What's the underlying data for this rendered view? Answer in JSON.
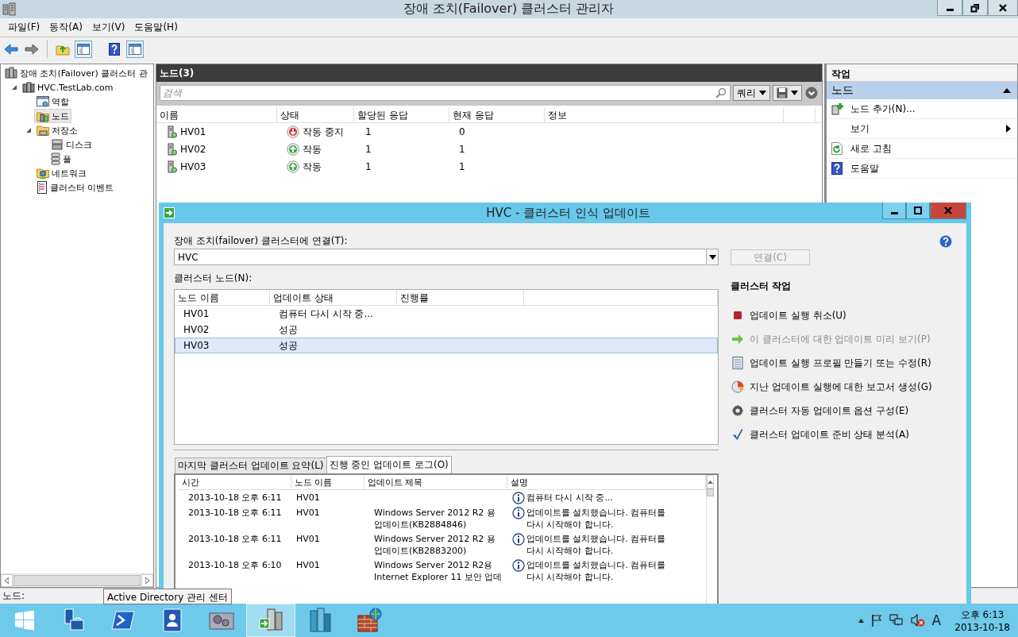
{
  "window": {
    "title": "장애 조치(Failover) 클러스터 관리자"
  },
  "menu": [
    "파일(F)",
    "동작(A)",
    "보기(V)",
    "도움말(H)"
  ],
  "tree": {
    "label": "장애 조치(Failover) 클러스터 관",
    "kind": "cluster",
    "selected": false,
    "children": [
      {
        "label": "HVC.TestLab.com",
        "kind": "server",
        "selected": false,
        "expanded": true,
        "children": [
          {
            "label": "역할",
            "kind": "roles",
            "selected": false
          },
          {
            "label": "노드",
            "kind": "nodes",
            "selected": true
          },
          {
            "label": "저장소",
            "kind": "storage",
            "selected": false,
            "expanded": true,
            "children": [
              {
                "label": "디스크",
                "kind": "disk",
                "selected": false
              },
              {
                "label": "풀",
                "kind": "pool",
                "selected": false
              }
            ]
          },
          {
            "label": "네트워크",
            "kind": "network",
            "selected": false
          },
          {
            "label": "클러스터 이벤트",
            "kind": "events",
            "selected": false
          }
        ]
      }
    ]
  },
  "center": {
    "title": "노드(3)",
    "search": {
      "placeholder": "검색"
    },
    "query_button": "쿼리",
    "columns": [
      "이름",
      "상태",
      "할당된 응답",
      "현재 응답",
      "정보"
    ],
    "rows": [
      {
        "name": "HV01",
        "status": "작동 중지",
        "kind": "down",
        "assigned": "1",
        "current": "0"
      },
      {
        "name": "HV02",
        "status": "작동",
        "kind": "up",
        "assigned": "1",
        "current": "1"
      },
      {
        "name": "HV03",
        "status": "작동",
        "kind": "up",
        "assigned": "1",
        "current": "1"
      }
    ]
  },
  "actions": {
    "title": "작업",
    "section": {
      "label": "노드",
      "expanded": true
    },
    "items": [
      {
        "label": "노드 추가(N)...",
        "kind": "add"
      },
      {
        "label": "보기",
        "kind": "submenu"
      },
      {
        "label": "새로 고침",
        "kind": "refresh"
      },
      {
        "label": "도움말",
        "kind": "help"
      }
    ]
  },
  "status_bar": "노드:",
  "dialog": {
    "title": "HVC - 클러스터 인식 업데이트",
    "connect_label": "장애 조치(failover) 클러스터에 연결(T):",
    "cluster_value": "HVC",
    "connect_button": {
      "label": "연결(C)",
      "disabled": true
    },
    "nodes_label": "클러스터 노드(N):",
    "node_columns": [
      "노드 이름",
      "업데이트 상태",
      "진행률"
    ],
    "nodes": [
      {
        "name": "HV01",
        "status": "컴퓨터 다시 시작 중...",
        "selected": false
      },
      {
        "name": "HV02",
        "status": "성공",
        "selected": false
      },
      {
        "name": "HV03",
        "status": "성공",
        "selected": true
      }
    ],
    "actions_title": "클러스터 작업",
    "actions": [
      {
        "label": "업데이트 실행 취소(U)",
        "kind": "stop",
        "disabled": false
      },
      {
        "label": "이 클러스터에 대한 업데이트 미리 보기(P)",
        "kind": "arrow",
        "disabled": true
      },
      {
        "label": "업데이트 실행 프로필 만들기 또는 수정(R)",
        "kind": "document",
        "disabled": false
      },
      {
        "label": "지난 업데이트 실행에 대한 보고서 생성(G)",
        "kind": "report",
        "disabled": false
      },
      {
        "label": "클러스터 자동 업데이트 옵션 구성(E)",
        "kind": "gear",
        "disabled": false
      },
      {
        "label": "클러스터 업데이트 준비 상태 분석(A)",
        "kind": "check",
        "disabled": false
      }
    ],
    "tabs": [
      {
        "label": "마지막 클러스터 업데이트 요약(L)",
        "selected": false
      },
      {
        "label": "진행 중인 업데이트 로그(O)",
        "selected": true
      }
    ],
    "log_columns": [
      "시간",
      "노드 이름",
      "업데이트 제목",
      "설명"
    ],
    "log_rows": [
      {
        "time": "2013-10-18 오후 6:11",
        "node": "HV01",
        "title": "",
        "description": "컴퓨터 다시 시작 중..."
      },
      {
        "time": "2013-10-18 오후 6:11",
        "node": "HV01",
        "title": "Windows Server 2012 R2 용\n업데이트(KB2884846)",
        "description": "업데이트를 설치했습니다. 컴퓨터를\n다시 시작해야 합니다."
      },
      {
        "time": "2013-10-18 오후 6:11",
        "node": "HV01",
        "title": "Windows Server 2012 R2 용\n업데이트(KB2883200)",
        "description": "업데이트를 설치했습니다. 컴퓨터를\n다시 시작해야 합니다."
      },
      {
        "time": "2013-10-18 오후 6:10",
        "node": "HV01",
        "title": "Windows Server 2012 R2용\nInternet Explorer 11 보안 업데",
        "description": "업데이트를 설치했습니다. 컴퓨터를\n다시 시작해야 합니다."
      }
    ]
  },
  "tooltip": "Active Directory 관리 센터",
  "taskbar": {
    "apps": [
      {
        "kind": "start",
        "selected": false
      },
      {
        "kind": "server-manager",
        "selected": false
      },
      {
        "kind": "powershell",
        "selected": false
      },
      {
        "kind": "directory",
        "selected": false
      },
      {
        "kind": "tools",
        "selected": false
      },
      {
        "kind": "cluster",
        "selected": true
      },
      {
        "kind": "buildings",
        "selected": false
      },
      {
        "kind": "firewall",
        "selected": false
      }
    ],
    "ime": "A",
    "time": "오후 6:13",
    "date": "2013-10-18"
  }
}
